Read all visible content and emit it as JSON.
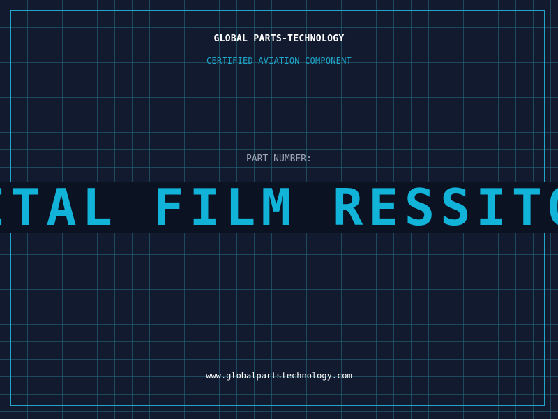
{
  "header": {
    "company": "GLOBAL PARTS-TECHNOLOGY",
    "tagline": "CERTIFIED AVIATION COMPONENT"
  },
  "part": {
    "label": "PART NUMBER:",
    "name": "METAL FILM RESSITOR"
  },
  "footer": {
    "website": "www.globalpartstechnology.com"
  },
  "colors": {
    "background": "#111a2e",
    "grid": "#286e82",
    "accent": "#12b3d9",
    "frame": "#1fa6c9",
    "band": "#0b1322"
  }
}
